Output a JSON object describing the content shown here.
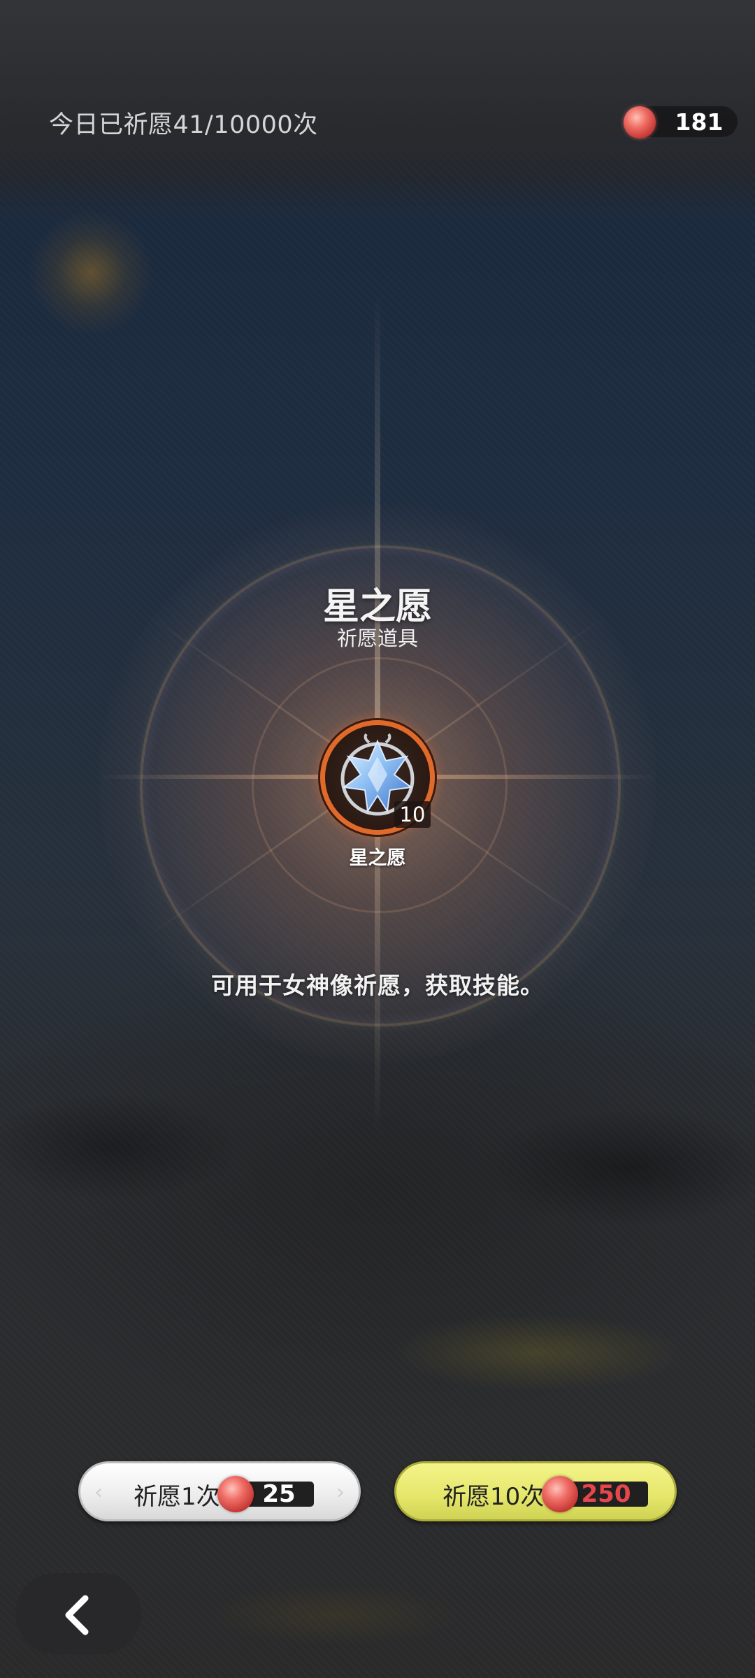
{
  "header": {
    "pray_count_text": "今日已祈愿41/10000次",
    "currency": {
      "icon": "red-orb-icon",
      "value": "181"
    }
  },
  "item": {
    "title": "星之愿",
    "subtitle": "祈愿道具",
    "icon": "star-crystal-icon",
    "quantity": "10",
    "label": "星之愿",
    "description": "可用于女神像祈愿，获取技能。"
  },
  "actions": {
    "pray_once": {
      "label": "祈愿1次",
      "cost": "25",
      "cost_icon": "red-orb-icon"
    },
    "pray_ten": {
      "label": "祈愿10次",
      "cost": "250",
      "cost_icon": "red-orb-icon"
    },
    "back_icon": "chevron-left-icon"
  },
  "colors": {
    "frame_orange": "#e06a2a",
    "ten_button_yellow": "#e5e66a",
    "ten_cost_red": "#e7474a",
    "orb_red": "#ef6e66"
  }
}
